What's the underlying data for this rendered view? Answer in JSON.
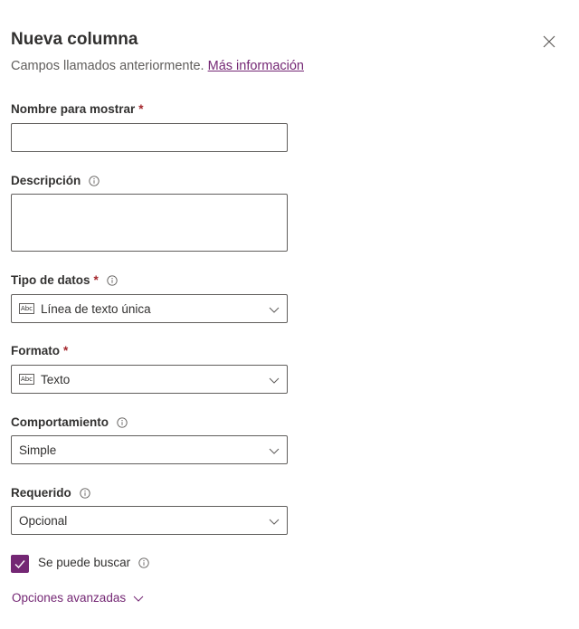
{
  "panel": {
    "title": "Nueva columna",
    "subtitle": "Campos llamados anteriormente.",
    "learn_more_link": "Más información"
  },
  "fields": {
    "display_name": {
      "label": "Nombre para mostrar",
      "required_mark": "*",
      "value": ""
    },
    "description": {
      "label": "Descripción",
      "value": ""
    },
    "data_type": {
      "label": "Tipo de datos",
      "required_mark": "*",
      "value": "Línea de texto única",
      "icon_text": "Abc"
    },
    "format": {
      "label": "Formato",
      "required_mark": "*",
      "value": "Texto",
      "icon_text": "Abc"
    },
    "behavior": {
      "label": "Comportamiento",
      "value": "Simple"
    },
    "required": {
      "label": "Requerido",
      "value": "Opcional"
    },
    "searchable": {
      "label": "Se puede buscar",
      "checked": true
    }
  },
  "advanced": {
    "label": "Opciones avanzadas"
  },
  "colors": {
    "accent": "#742774",
    "required_star": "#a4262c",
    "border": "#605e5c"
  }
}
